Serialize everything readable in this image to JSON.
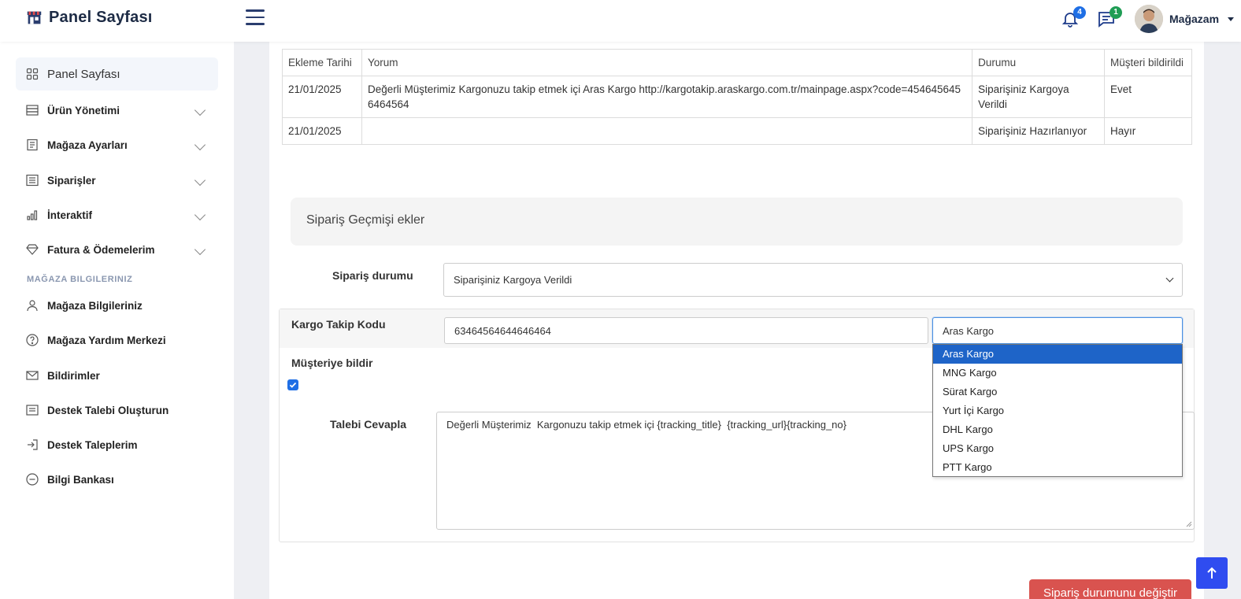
{
  "header": {
    "brand_title": "Panel Sayfası",
    "notifications_count": "4",
    "messages_count": "1",
    "user_name": "Mağazam"
  },
  "sidebar": {
    "items": [
      {
        "label": "Panel Sayfası",
        "icon": "grid-icon"
      },
      {
        "label": "Ürün Yönetimi",
        "icon": "server-icon"
      },
      {
        "label": "Mağaza Ayarları",
        "icon": "file-text-icon"
      },
      {
        "label": "Siparişler",
        "icon": "list-icon"
      },
      {
        "label": "İnteraktif",
        "icon": "bar-chart-icon"
      },
      {
        "label": "Fatura & Ödemelerim",
        "icon": "diamond-icon"
      }
    ],
    "section_title": "MAĞAZA BILGILERINIZ",
    "section_items": [
      {
        "label": "Mağaza Bilgileriniz",
        "icon": "user-icon"
      },
      {
        "label": "Mağaza Yardım Merkezi",
        "icon": "help-circle-icon"
      },
      {
        "label": "Bildirimler",
        "icon": "mail-icon"
      },
      {
        "label": "Destek Talebi Oluşturun",
        "icon": "list-alt-icon"
      },
      {
        "label": "Destek Taleplerim",
        "icon": "log-in-icon"
      },
      {
        "label": "Bilgi Bankası",
        "icon": "minus-circle-icon"
      }
    ]
  },
  "history_table": {
    "headers": [
      "Ekleme Tarihi",
      "Yorum",
      "Durumu",
      "Müşteri bildirildi"
    ],
    "rows": [
      [
        "21/01/2025",
        "Değerli Müşterimiz Kargonuzu takip etmek içi Aras Kargo http://kargotakip.araskargo.com.tr/mainpage.aspx?code=4546456456464564",
        "Siparişiniz Kargoya Verildi",
        "Evet"
      ],
      [
        "21/01/2025",
        "",
        "Siparişiniz Hazırlanıyor",
        "Hayır"
      ]
    ]
  },
  "form": {
    "section_title": "Sipariş Geçmişi ekler",
    "status_label": "Sipariş durumu",
    "status_value": "Siparişiniz Kargoya Verildi",
    "tracking_label": "Kargo Takip Kodu",
    "tracking_value": "63464564644646464",
    "carrier_value": "Aras Kargo",
    "notify_label": "Müşteriye bildir",
    "notify_checked": true,
    "reply_label": "Talebi Cevapla",
    "reply_value": "Değerli Müşterimiz  Kargonuzu takip etmek içi {tracking_title}  {tracking_url}{tracking_no}",
    "submit_label": "Sipariş durumunu değiştir"
  },
  "carrier_options": [
    "Aras Kargo",
    "MNG Kargo",
    "Sürat Kargo",
    "Yurt İçi Kargo",
    "DHL Kargo",
    "UPS Kargo",
    "PTT Kargo"
  ],
  "carrier_selected_index": 0,
  "colors": {
    "accent": "#1e64c8",
    "danger": "#d9534f",
    "scroll_top": "#2f4cf0",
    "badge_notifications": "#1f6fe5",
    "badge_messages": "#1f9d55"
  }
}
